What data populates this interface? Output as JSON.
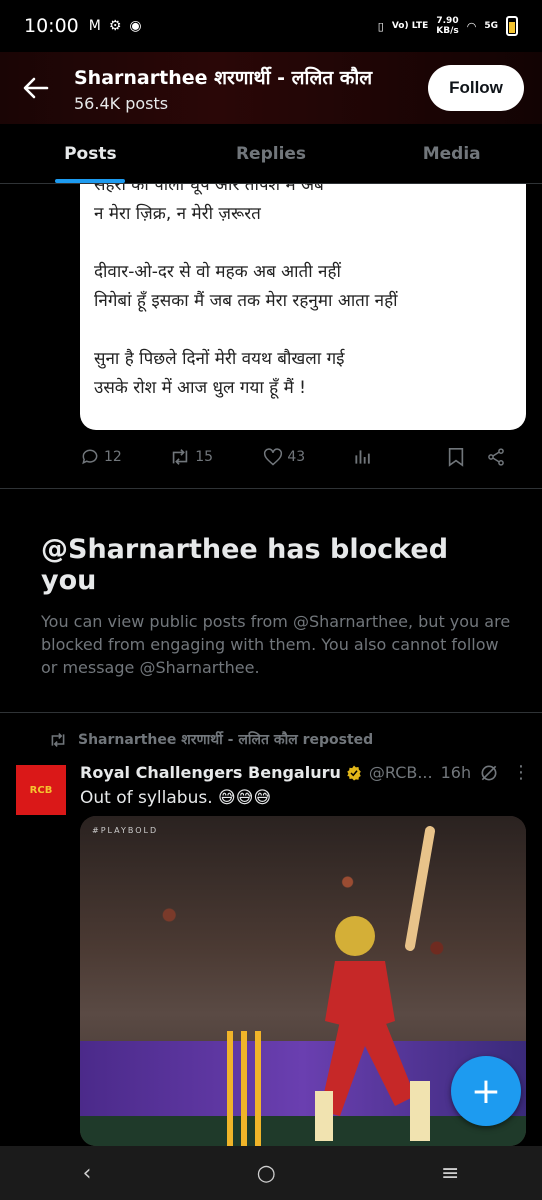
{
  "status_bar": {
    "time": "10:00",
    "network_volte": "Vo) LTE",
    "speed_value": "7.90",
    "speed_unit": "KB/s",
    "network_type": "5G"
  },
  "header": {
    "title": "Sharnarthee शरणार्थी - ललित कौल",
    "posts_count": "56.4K posts",
    "follow_label": "Follow"
  },
  "tabs": [
    {
      "label": "Posts",
      "active": true
    },
    {
      "label": "Replies",
      "active": false
    },
    {
      "label": "Media",
      "active": false
    }
  ],
  "post_image": {
    "clipped_line": "सहरा की पाली धूप और तपिश में अब",
    "lines": [
      "न मेरा ज़िक्र, न मेरी ज़रूरत",
      "",
      "दीवार-ओ-दर से वो महक अब आती नहीं",
      "निगेबां हूँ इसका मैं जब तक मेरा रहनुमा आता नहीं",
      "",
      "सुना है पिछले दिनों मेरी वयथ बौखला गई",
      "उसके रोश में आज धुल गया हूँ मैं !"
    ]
  },
  "post_actions": {
    "replies": "12",
    "reposts": "15",
    "likes": "43"
  },
  "blocked": {
    "title": "@Sharnarthee has blocked you",
    "body": "You can view public posts from @Sharnarthee, but you are blocked from engaging with them. You also cannot follow or message @Sharnarthee."
  },
  "repost": {
    "label": "Sharnarthee शरणार्थी - ललित कौल reposted",
    "avatar_text": "RCB",
    "name": "Royal Challengers Bengaluru",
    "handle": "@RCB...",
    "time": "16h",
    "text": "Out of syllabus. 😅😅😅",
    "photo_tag": "#PLAYBOLD"
  },
  "colors": {
    "accent": "#1d9bf0",
    "background": "#000000",
    "muted": "#71767b"
  }
}
